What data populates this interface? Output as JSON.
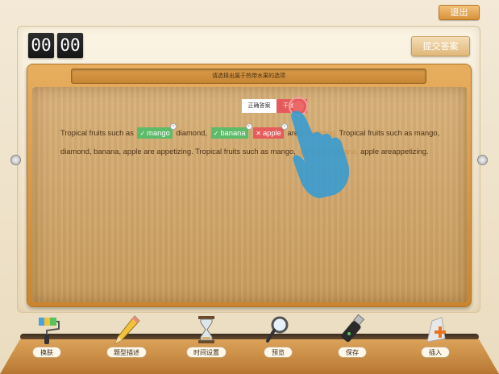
{
  "header": {
    "exit_label": "退出"
  },
  "timer": {
    "minutes": "00",
    "seconds": "00"
  },
  "toolbar_top": {
    "submit_label": "提交答案"
  },
  "question": {
    "prompt": "请选择出属于热带水果的选项"
  },
  "answer_toggle": {
    "correct_label": "正确答案",
    "distractor_label": "干扰"
  },
  "passage": {
    "prefix": "Tropical fruits such as",
    "chip1": "mango",
    "between1": "diamond,",
    "chip2": "banana",
    "chip3": "apple",
    "between2": "are",
    "faded1": "appetizing.",
    "rest1": "Tropical fruits such as mango, diamond, banana, apple are appetizing. Tropical fruits such as mango,",
    "faded2": "diamond,",
    "mid": "",
    "faded3": "banana,",
    "tail": "apple areappetizing."
  },
  "tools": [
    {
      "icon": "paint-roller-icon",
      "label": "换肤"
    },
    {
      "icon": "pencil-icon",
      "label": "题型描述"
    },
    {
      "icon": "hourglass-icon",
      "label": "时间设置"
    },
    {
      "icon": "magnifier-icon",
      "label": "预览"
    },
    {
      "icon": "usb-drive-icon",
      "label": "保存"
    },
    {
      "icon": "insert-icon",
      "label": "插入"
    }
  ],
  "colors": {
    "correct_chip": "#5dbb69",
    "distractor_chip": "#e45c5c",
    "exit_button": "#e0a04a",
    "hand_pointer": "#2f9bd6"
  }
}
